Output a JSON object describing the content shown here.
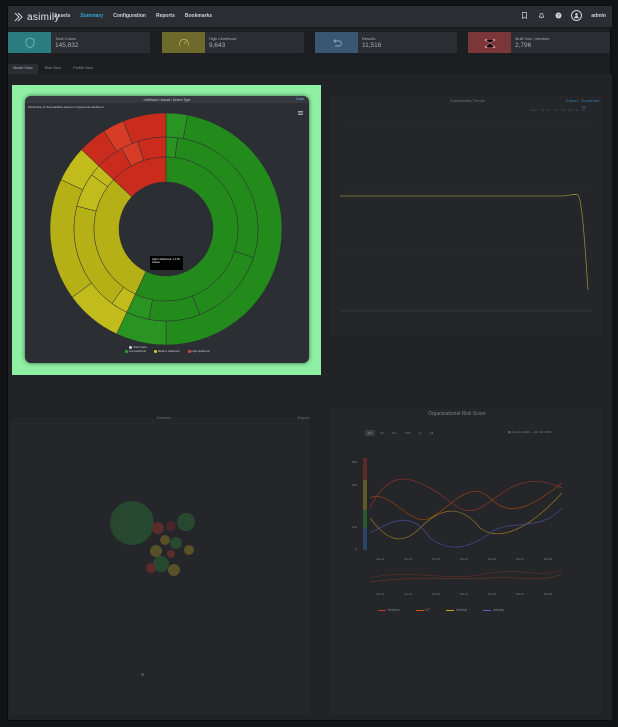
{
  "app": {
    "logo": "asimily",
    "nav": [
      {
        "label": "Assets",
        "active": false
      },
      {
        "label": "Summary",
        "active": true
      },
      {
        "label": "Configuration",
        "active": false
      },
      {
        "label": "Reports",
        "active": false
      },
      {
        "label": "Bookmarks",
        "active": false
      }
    ],
    "user": "admin"
  },
  "stats": [
    {
      "label": "Total Cases",
      "value": "145,832",
      "color": "#2a7d7e",
      "icon": "shield-icon"
    },
    {
      "label": "High Likelihood",
      "value": "9,643",
      "color": "#6e6a2c",
      "icon": "gauge-icon"
    },
    {
      "label": "Results",
      "value": "11,516",
      "color": "#3b5673",
      "icon": "undo-icon"
    },
    {
      "label": "Multi Vuln. Vendors",
      "value": "2,796",
      "color": "#7a3638",
      "icon": "network-icon"
    }
  ],
  "tabs": [
    {
      "label": "Model View",
      "active": true
    },
    {
      "label": "Risk View",
      "active": false
    },
    {
      "label": "Profile View",
      "active": false
    }
  ],
  "modal": {
    "title": "Likelihood / Impact / Device Type",
    "close": "Close",
    "subtitle": "Distribution of Vulnerabilities based on Impact and Likelihood",
    "center_label": "9,643\nAll Types",
    "tooltip_line1": "High Likelihood: 1,178",
    "tooltip_line2": "Cases",
    "legend": [
      {
        "label": "Total Cases",
        "color": "#cfd3d8"
      },
      {
        "label": "Low Likelihood",
        "color": "#2fa832"
      },
      {
        "label": "Medium Likelihood",
        "color": "#d9cf2a"
      },
      {
        "label": "High Likelihood",
        "color": "#e04836"
      }
    ]
  },
  "sunburst": {
    "inner": [
      {
        "name": "All Types",
        "value": 100,
        "color": "#9b5f66"
      }
    ],
    "ring2": [
      {
        "name": "Low",
        "value": 57,
        "color": "#238a1c"
      },
      {
        "name": "Medium",
        "value": 30,
        "color": "#b5b015"
      },
      {
        "name": "High",
        "value": 13,
        "color": "#c92b1c"
      }
    ],
    "ring3": [
      {
        "value": 2,
        "color": "#2a9422"
      },
      {
        "value": 28,
        "color": "#238a1c"
      },
      {
        "value": 14,
        "color": "#238a1c"
      },
      {
        "value": 9,
        "color": "#238a1c"
      },
      {
        "value": 4,
        "color": "#2a9422"
      },
      {
        "value": 3,
        "color": "#c1bb1c"
      },
      {
        "value": 19,
        "color": "#b5b015"
      },
      {
        "value": 6,
        "color": "#c1bb1c"
      },
      {
        "value": 2,
        "color": "#c1bb1c"
      },
      {
        "value": 5,
        "color": "#c92b1c"
      },
      {
        "value": 3,
        "color": "#d63c26"
      },
      {
        "value": 5,
        "color": "#c92b1c"
      }
    ],
    "ring4": [
      {
        "value": 3,
        "color": "#2a9422"
      },
      {
        "value": 47,
        "color": "#238a1c"
      },
      {
        "value": 7,
        "color": "#2a9422"
      },
      {
        "value": 8,
        "color": "#c1bb1c"
      },
      {
        "value": 17,
        "color": "#b5b015"
      },
      {
        "value": 5,
        "color": "#c1bb1c"
      },
      {
        "value": 4,
        "color": "#c92b1c"
      },
      {
        "value": 3,
        "color": "#d63c26"
      },
      {
        "value": 6,
        "color": "#c92b1c"
      }
    ]
  },
  "line_panel": {
    "title": "Vulnerability Trends",
    "controls": [
      "Zoom",
      "1d",
      "1w",
      "1m",
      "3m",
      "6m",
      "1y",
      "All"
    ],
    "links": [
      "Export",
      "Download"
    ]
  },
  "bubble_panel": {
    "title": "Devices",
    "link": "Export"
  },
  "risk_panel": {
    "title": "Organizational Risk Score",
    "ranges": [
      "1m",
      "3m",
      "6m",
      "YTD",
      "1y",
      "All"
    ],
    "date_range": "Jan 24, 2018 — Feb 20, 2018",
    "y_ticks": [
      "300",
      "200",
      "100",
      "0"
    ],
    "x_ticks": [
      "Jan 24",
      "Jan 31",
      "Feb 07",
      "Feb 14",
      "Feb 20",
      "Feb 27",
      "Mar 06"
    ],
    "legend": [
      {
        "label": "Network",
        "color": "#c0392b"
      },
      {
        "label": "IoT",
        "color": "#d35400"
      },
      {
        "label": "Medical",
        "color": "#d4a017"
      },
      {
        "label": "Industry",
        "color": "#5b5fc7"
      }
    ]
  }
}
